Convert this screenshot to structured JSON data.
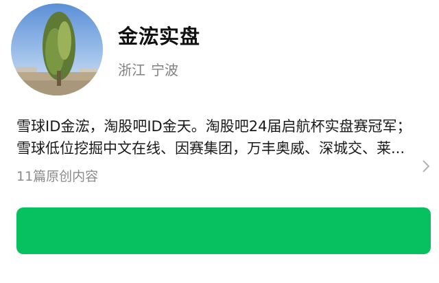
{
  "profile": {
    "name": "金浤实盘",
    "location": {
      "province": "浙江",
      "city": "宁波"
    },
    "description": {
      "line1": "雪球ID金浤，淘股吧ID金天。淘股吧24届启航杯实盘赛冠军；",
      "line2": "雪球低位挖掘中文在线、因赛集团，万丰奥威、深城交、莱..."
    },
    "article_count": "11篇原创内容"
  },
  "colors": {
    "accent": "#07c160",
    "title": "#111111",
    "secondary_text": "#7f7f7f"
  },
  "icons": {
    "expand": "chevron-right-icon"
  }
}
